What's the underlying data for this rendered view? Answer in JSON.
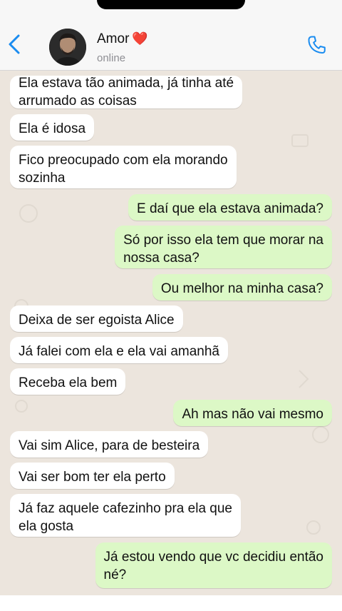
{
  "header": {
    "contact_name": "Amor",
    "name_emoji": "❤️",
    "status": "online"
  },
  "icons": {
    "back": "chevron-left-icon",
    "call": "phone-icon",
    "accent": "#1a8cf0"
  },
  "colors": {
    "incoming_bubble": "#ffffff",
    "outgoing_bubble": "#dcf8c6",
    "chat_background": "#ece5dd"
  },
  "messages": [
    {
      "direction": "in",
      "text": "Ela estava tão animada, já tinha até\narrumado as coisas"
    },
    {
      "direction": "in",
      "text": "Ela é idosa"
    },
    {
      "direction": "in",
      "text": "Fico preocupado com ela morando\nsozinha"
    },
    {
      "direction": "out",
      "text": "E daí que ela estava animada?"
    },
    {
      "direction": "out",
      "text": "Só por isso ela tem que morar na\nnossa casa?"
    },
    {
      "direction": "out",
      "text": "Ou melhor na minha casa?"
    },
    {
      "direction": "in",
      "text": "Deixa de ser egoista Alice"
    },
    {
      "direction": "in",
      "text": "Já falei com ela e ela vai amanhã"
    },
    {
      "direction": "in",
      "text": "Receba ela bem"
    },
    {
      "direction": "out",
      "text": "Ah mas não vai mesmo"
    },
    {
      "direction": "in",
      "text": "Vai sim Alice, para de besteira"
    },
    {
      "direction": "in",
      "text": "Vai ser bom ter ela perto"
    },
    {
      "direction": "in",
      "text": "Já faz aquele cafezinho pra ela que\nela gosta"
    },
    {
      "direction": "out",
      "text": "Já estou vendo que vc decidiu então\nné?"
    }
  ]
}
